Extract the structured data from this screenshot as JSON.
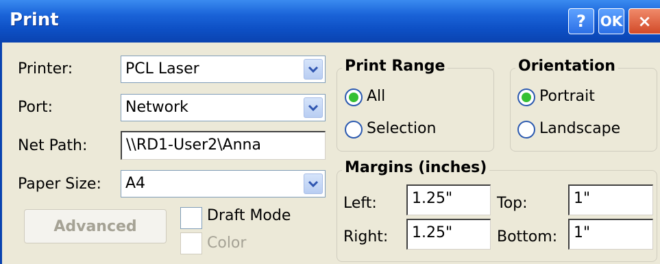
{
  "window": {
    "title": "Print",
    "help_label": "?",
    "ok_label": "OK",
    "close_label": "×"
  },
  "form": {
    "printer_label": "Printer:",
    "printer_value": "PCL Laser",
    "port_label": "Port:",
    "port_value": "Network",
    "netpath_label": "Net Path:",
    "netpath_value": "\\\\RD1-User2\\Anna",
    "papersize_label": "Paper Size:",
    "papersize_value": "A4",
    "advanced_label": "Advanced",
    "draftmode_label": "Draft Mode",
    "draftmode_checked": false,
    "color_label": "Color",
    "color_checked": false,
    "color_enabled": false
  },
  "print_range": {
    "title": "Print Range",
    "options": [
      "All",
      "Selection"
    ],
    "selected": "All"
  },
  "orientation": {
    "title": "Orientation",
    "options": [
      "Portrait",
      "Landscape"
    ],
    "selected": "Portrait"
  },
  "margins": {
    "title": "Margins (inches)",
    "left_label": "Left:",
    "left_value": "1.25\"",
    "right_label": "Right:",
    "right_value": "1.25\"",
    "top_label": "Top:",
    "top_value": "1\"",
    "bottom_label": "Bottom:",
    "bottom_value": "1\""
  },
  "icons": {
    "dropdown": "chevron-down-icon",
    "help": "help-icon",
    "close": "close-icon"
  },
  "colors": {
    "titlebar": "#0a43b0",
    "dialog_bg": "#ece9d8",
    "radio_dot": "#35c033"
  }
}
